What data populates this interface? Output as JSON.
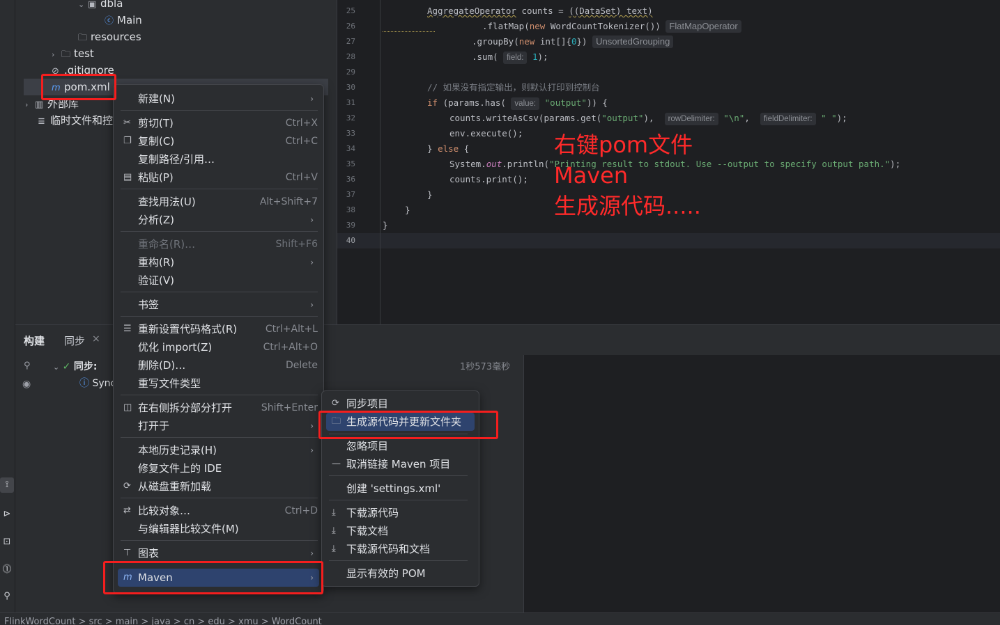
{
  "project_tree": {
    "items": [
      {
        "label": "dbla",
        "icon": "package-icon"
      },
      {
        "label": "Main",
        "icon": "java-class-icon"
      },
      {
        "label": "resources",
        "icon": "folder-icon"
      },
      {
        "label": "test",
        "icon": "folder-icon"
      },
      {
        "label": ".gitignore",
        "icon": "gitignore-icon"
      },
      {
        "label": "pom.xml",
        "icon": "maven-icon"
      },
      {
        "label": "外部库",
        "icon": "library-icon"
      },
      {
        "label": "临时文件和控",
        "icon": "scratch-icon"
      }
    ]
  },
  "editor": {
    "line_numbers": [
      "25",
      "26",
      "27",
      "28",
      "29",
      "30",
      "31",
      "32",
      "33",
      "34",
      "35",
      "36",
      "37",
      "38",
      "39",
      "40"
    ],
    "hints": {
      "flatmap": "FlatMapOperator",
      "groupby": "UnsortedGrouping",
      "field": "field:",
      "value": "value:",
      "row_delim": "rowDelimiter:",
      "field_delim": "fieldDelimiter:"
    },
    "comment": "// 如果没有指定输出，则默认打印到控制台"
  },
  "annotation": {
    "line1": "右键pom文件",
    "line2": "Maven",
    "line3": "生成源代码....."
  },
  "build_panel": {
    "tab_build": "构建",
    "tab_sync": "同步",
    "sync_label": "同步:",
    "sync_item": "Sync",
    "duration": "1秒573毫秒"
  },
  "status_bar": {
    "breadcrumb": "FlinkWordCount  >  src  >  main  >  java  >  cn  >  edu  >  xmu  >  WordCount"
  },
  "context_menu": {
    "items": [
      {
        "label": "新建(N)",
        "shortcut": "",
        "submenu": true
      },
      {
        "label": "剪切(T)",
        "shortcut": "Ctrl+X"
      },
      {
        "label": "复制(C)",
        "shortcut": "Ctrl+C"
      },
      {
        "label": "复制路径/引用…",
        "shortcut": ""
      },
      {
        "label": "粘贴(P)",
        "shortcut": "Ctrl+V"
      },
      {
        "label": "查找用法(U)",
        "shortcut": "Alt+Shift+7"
      },
      {
        "label": "分析(Z)",
        "shortcut": "",
        "submenu": true
      },
      {
        "label": "重命名(R)…",
        "shortcut": "Shift+F6",
        "disabled": true
      },
      {
        "label": "重构(R)",
        "shortcut": "",
        "submenu": true
      },
      {
        "label": "验证(V)",
        "shortcut": ""
      },
      {
        "label": "书签",
        "shortcut": "",
        "submenu": true
      },
      {
        "label": "重新设置代码格式(R)",
        "shortcut": "Ctrl+Alt+L"
      },
      {
        "label": "优化 import(Z)",
        "shortcut": "Ctrl+Alt+O"
      },
      {
        "label": "删除(D)…",
        "shortcut": "Delete"
      },
      {
        "label": "重写文件类型",
        "shortcut": ""
      },
      {
        "label": "在右侧拆分部分打开",
        "shortcut": "Shift+Enter"
      },
      {
        "label": "打开于",
        "shortcut": "",
        "submenu": true
      },
      {
        "label": "本地历史记录(H)",
        "shortcut": "",
        "submenu": true
      },
      {
        "label": "修复文件上的 IDE",
        "shortcut": ""
      },
      {
        "label": "从磁盘重新加载",
        "shortcut": ""
      },
      {
        "label": "比较对象…",
        "shortcut": "Ctrl+D"
      },
      {
        "label": "与编辑器比较文件(M)",
        "shortcut": ""
      },
      {
        "label": "图表",
        "shortcut": "",
        "submenu": true
      },
      {
        "label": "Maven",
        "shortcut": "",
        "submenu": true,
        "highlighted": true
      }
    ]
  },
  "maven_submenu": {
    "items": [
      {
        "label": "同步项目"
      },
      {
        "label": "生成源代码并更新文件夹",
        "highlighted": true
      },
      {
        "label": "忽略项目"
      },
      {
        "label": "取消链接 Maven 项目"
      },
      {
        "label": "创建 'settings.xml'"
      },
      {
        "label": "下载源代码"
      },
      {
        "label": "下载文档"
      },
      {
        "label": "下载源代码和文档"
      },
      {
        "label": "显示有效的 POM"
      }
    ]
  },
  "colors": {
    "accent_highlight": "#2e436e",
    "annotation_red": "#ff2a2a",
    "box_red": "#f41e1e"
  }
}
